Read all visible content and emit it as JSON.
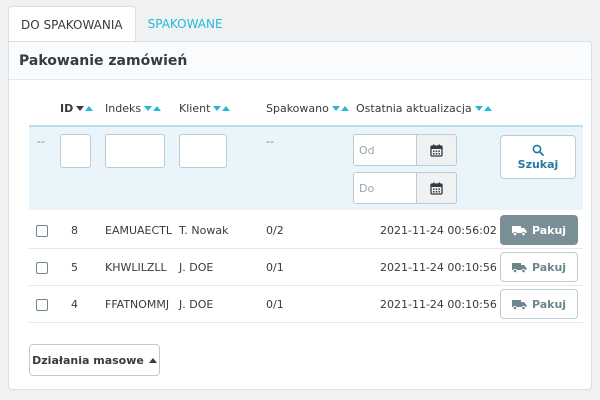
{
  "tabs": [
    {
      "label": "DO SPAKOWANIA",
      "active": true
    },
    {
      "label": "SPAKOWANE",
      "active": false
    }
  ],
  "panel": {
    "title": "Pakowanie zamówień"
  },
  "columns": {
    "id": "ID",
    "index": "Indeks",
    "client": "Klient",
    "packed": "Spakowano",
    "updated": "Ostatnia aktualizacja"
  },
  "filters": {
    "checkbox_col": "--",
    "packed_col": "--",
    "date_from_placeholder": "Od",
    "date_to_placeholder": "Do",
    "search_label": "Szukaj"
  },
  "rows": [
    {
      "id": "8",
      "index": "EAMUAECTL",
      "client": "T. Nowak",
      "packed": "0/2",
      "updated": "2021-11-24 00:56:02",
      "action": "Pakuj",
      "highlighted": true
    },
    {
      "id": "5",
      "index": "KHWLILZLL",
      "client": "J. DOE",
      "packed": "0/1",
      "updated": "2021-11-24 00:10:56",
      "action": "Pakuj",
      "highlighted": false
    },
    {
      "id": "4",
      "index": "FFATNOMMJ",
      "client": "J. DOE",
      "packed": "0/1",
      "updated": "2021-11-24 00:10:56",
      "action": "Pakuj",
      "highlighted": false
    }
  ],
  "bulk_actions": {
    "label": "Działania masowe"
  },
  "icons": {
    "sort": "sort-arrows-icon",
    "calendar": "calendar-icon",
    "search": "search-icon",
    "truck": "truck-icon",
    "caret": "caret-up-icon"
  },
  "colors": {
    "accent": "#25b9d7",
    "filter_bg": "#eaf5fb",
    "active_button": "#7a8f96"
  }
}
